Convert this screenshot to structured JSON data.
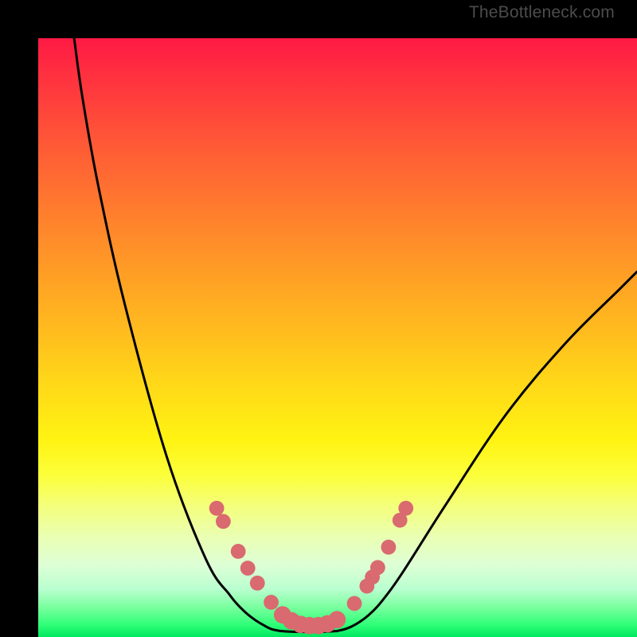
{
  "watermark": {
    "text": "TheBottleneck.com"
  },
  "chart_data": {
    "type": "line",
    "title": "",
    "xlabel": "",
    "ylabel": "",
    "xlim": [
      0,
      100
    ],
    "ylim": [
      0,
      100
    ],
    "grid": false,
    "legend": false,
    "series": [
      {
        "name": "left-curve",
        "x": [
          6,
          7.4,
          10.1,
          14.6,
          21.5,
          28,
          32,
          34.2,
          36,
          37.6,
          39,
          40.5
        ],
        "y": [
          100,
          90,
          75,
          55,
          30,
          13,
          7,
          4.5,
          3,
          2,
          1.3,
          1
        ]
      },
      {
        "name": "valley-floor",
        "x": [
          40.5,
          42,
          44,
          46,
          48,
          49.9
        ],
        "y": [
          1,
          0.9,
          0.85,
          0.85,
          0.9,
          1
        ]
      },
      {
        "name": "right-curve",
        "x": [
          49.9,
          51.5,
          53,
          55,
          57.4,
          61,
          68,
          78,
          88,
          97,
          100
        ],
        "y": [
          1,
          1.4,
          2.1,
          3.5,
          6,
          11,
          22,
          37,
          49,
          58,
          61
        ]
      }
    ],
    "markers": {
      "name": "highlighted-points",
      "points": [
        {
          "x": 29.8,
          "y": 21.5,
          "r": 1.25
        },
        {
          "x": 30.9,
          "y": 19.3,
          "r": 1.25
        },
        {
          "x": 33.4,
          "y": 14.3,
          "r": 1.25
        },
        {
          "x": 35.0,
          "y": 11.5,
          "r": 1.25
        },
        {
          "x": 36.6,
          "y": 9.0,
          "r": 1.25
        },
        {
          "x": 38.9,
          "y": 5.8,
          "r": 1.25
        },
        {
          "x": 40.8,
          "y": 3.7,
          "r": 1.45
        },
        {
          "x": 42.3,
          "y": 2.7,
          "r": 1.45
        },
        {
          "x": 43.8,
          "y": 2.1,
          "r": 1.45
        },
        {
          "x": 45.3,
          "y": 1.9,
          "r": 1.45
        },
        {
          "x": 46.8,
          "y": 1.9,
          "r": 1.45
        },
        {
          "x": 48.3,
          "y": 2.2,
          "r": 1.45
        },
        {
          "x": 49.9,
          "y": 2.9,
          "r": 1.45
        },
        {
          "x": 52.8,
          "y": 5.6,
          "r": 1.25
        },
        {
          "x": 54.9,
          "y": 8.5,
          "r": 1.25
        },
        {
          "x": 55.8,
          "y": 10.0,
          "r": 1.25
        },
        {
          "x": 56.7,
          "y": 11.6,
          "r": 1.25
        },
        {
          "x": 58.5,
          "y": 15.0,
          "r": 1.25
        },
        {
          "x": 60.4,
          "y": 19.5,
          "r": 1.25
        },
        {
          "x": 61.4,
          "y": 21.5,
          "r": 1.25
        }
      ]
    },
    "background": {
      "type": "vertical-gradient",
      "description": "red at top through orange, yellow, pale, to green at bottom",
      "stops": [
        {
          "pos": 0.0,
          "color": "#ff1a44"
        },
        {
          "pos": 0.28,
          "color": "#ff7a2e"
        },
        {
          "pos": 0.58,
          "color": "#ffd918"
        },
        {
          "pos": 0.78,
          "color": "#f4ff7a"
        },
        {
          "pos": 0.92,
          "color": "#b9ffcf"
        },
        {
          "pos": 1.0,
          "color": "#00e860"
        }
      ]
    }
  }
}
